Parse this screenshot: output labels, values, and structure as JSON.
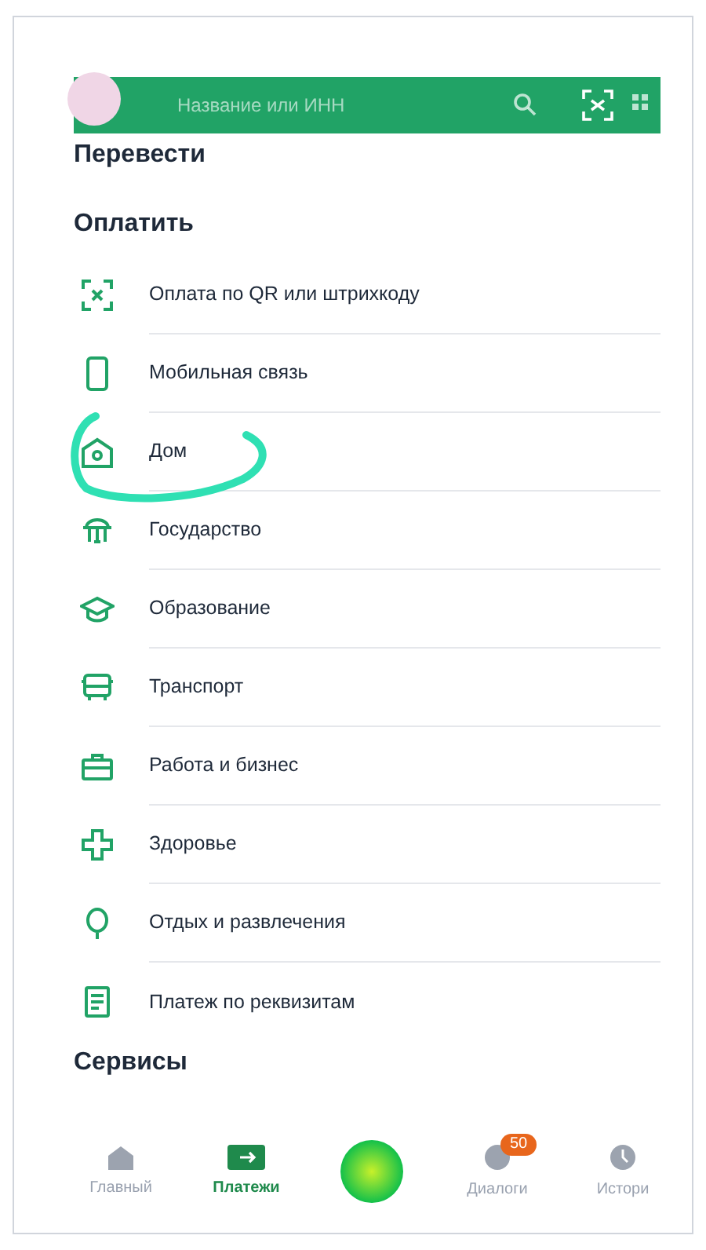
{
  "search": {
    "placeholder": "Название или ИНН"
  },
  "sections": [
    {
      "title": "Перевести"
    },
    {
      "title": "Оплатить"
    }
  ],
  "items": [
    {
      "kind": "qr",
      "label": "Оплата по QR или штрихкоду",
      "highlighted": false
    },
    {
      "kind": "phone",
      "label": "Мобильная связь",
      "highlighted": false
    },
    {
      "kind": "home",
      "label": "Дом",
      "highlighted": true
    },
    {
      "kind": "state",
      "label": "Государство",
      "highlighted": false
    },
    {
      "kind": "edu",
      "label": "Образование",
      "highlighted": false
    },
    {
      "kind": "bus",
      "label": "Транспорт",
      "highlighted": false
    },
    {
      "kind": "work",
      "label": "Работа и бизнес",
      "highlighted": false
    },
    {
      "kind": "health",
      "label": "Здоровье",
      "highlighted": false
    },
    {
      "kind": "leisure",
      "label": "Отдых и развлечения",
      "highlighted": false
    },
    {
      "kind": "doc",
      "label": "Платеж по реквизитам",
      "highlighted": false
    }
  ],
  "footer_section": {
    "title": "Сервисы"
  },
  "nav": [
    {
      "kind": "home",
      "label": "Главный",
      "selected": false
    },
    {
      "kind": "pay",
      "label": "Платежи",
      "selected": true
    },
    {
      "kind": "assistant"
    },
    {
      "kind": "chat",
      "label": "Диалоги",
      "selected": false,
      "badge": "50"
    },
    {
      "kind": "history",
      "label": "Истори",
      "selected": false
    }
  ]
}
